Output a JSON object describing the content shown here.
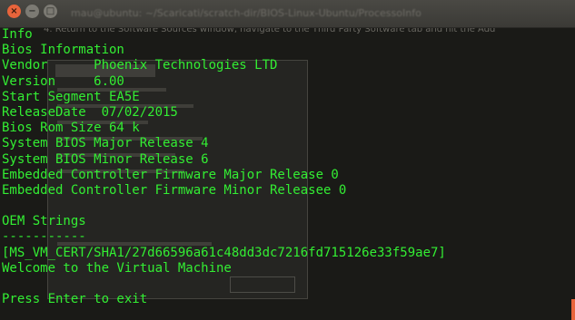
{
  "window": {
    "close_label": "×",
    "minimize_label": "−",
    "maximize_label": "□",
    "title": "mau@ubuntu: ~/Scaricati/scratch-dir/BIOS-Linux-Ubuntu/ProcessoInfo"
  },
  "background": {
    "text": "4. Return to the Software Sources window, navigate to the Third Party Software tab and hit the Add"
  },
  "terminal": {
    "lines": [
      "Info",
      "Bios Information",
      "Vendor      Phoenix Technologies LTD",
      "Version     6.00",
      "Start Segment EA5E",
      "ReleaseDate  07/02/2015",
      "Bios Rom Size 64 k",
      "System BIOS Major Release 4",
      "System BIOS Minor Release 6",
      "Embedded Controller Firmware Major Release 0",
      "Embedded Controller Firmware Minor Releasee 0",
      "",
      "OEM Strings",
      "-----------",
      "[MS_VM_CERT/SHA1/27d66596a61c48dd3dc7216fd715126e33f59ae7]",
      "Welcome to the Virtual Machine",
      "",
      "Press Enter to exit"
    ],
    "text_color": "#33ee33",
    "background_color": "#1a1a17"
  },
  "scrollbar": {
    "color": "#e8643b"
  }
}
